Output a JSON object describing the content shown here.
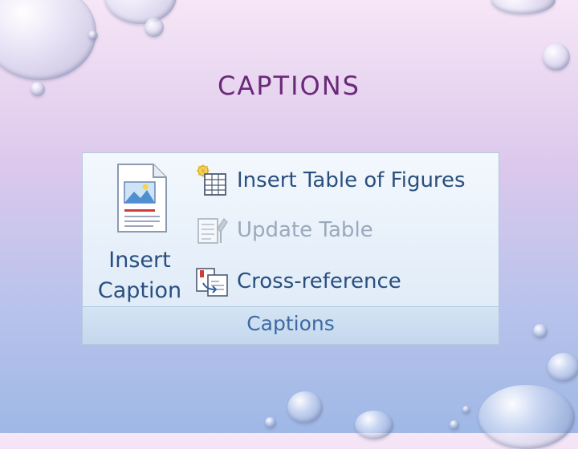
{
  "slide": {
    "title": "CAPTIONS"
  },
  "ribbon": {
    "group_label": "Captions",
    "insert_caption": {
      "line1": "Insert",
      "line2": "Caption",
      "icon": "insert-caption-icon"
    },
    "commands": [
      {
        "label": "Insert Table of Figures",
        "icon": "table-of-figures-icon",
        "enabled": true
      },
      {
        "label": "Update Table",
        "icon": "update-table-icon",
        "enabled": false
      },
      {
        "label": "Cross-reference",
        "icon": "cross-reference-icon",
        "enabled": true
      }
    ]
  },
  "colors": {
    "title": "#6b2a79",
    "ribbon_text": "#2a4f7f",
    "disabled_text": "#9aa9bb",
    "group_label": "#3e6aa0"
  }
}
